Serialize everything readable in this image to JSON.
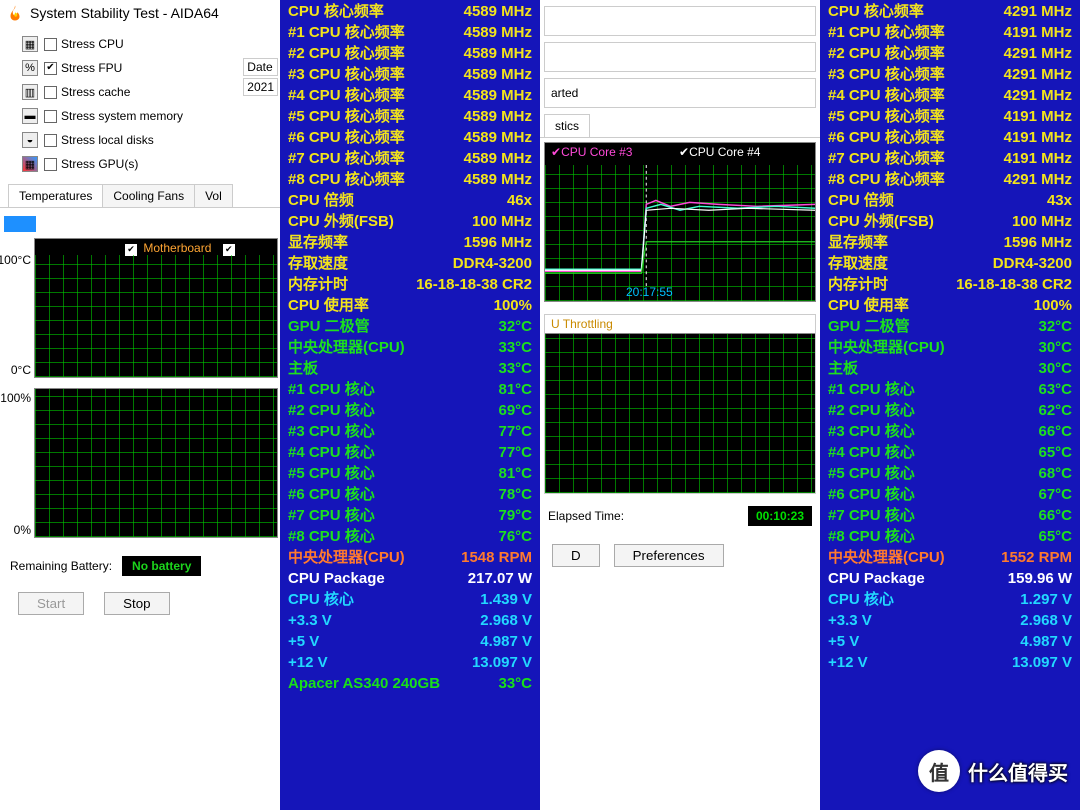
{
  "window": {
    "title": "System Stability Test - AIDA64"
  },
  "stress": {
    "cpu": {
      "label": "Stress CPU",
      "checked": false
    },
    "fpu": {
      "label": "Stress FPU",
      "checked": true
    },
    "cache": {
      "label": "Stress cache",
      "checked": false
    },
    "mem": {
      "label": "Stress system memory",
      "checked": false
    },
    "disks": {
      "label": "Stress local disks",
      "checked": false
    },
    "gpu": {
      "label": "Stress GPU(s)",
      "checked": false
    }
  },
  "date_label": "Date",
  "date_val": "2021",
  "tabs": {
    "temp": "Temperatures",
    "fans": "Cooling Fans",
    "vol": "Vol"
  },
  "mid_tab": "stics",
  "motherboard_label": "Motherboard",
  "graph1": {
    "y_top": "100°C",
    "y_bot": "0°C"
  },
  "graph2": {
    "y_top": "100%",
    "y_bot": "0%"
  },
  "mid_started": "arted",
  "cores": {
    "c3": "CPU Core #3",
    "c4": "CPU Core #4"
  },
  "timestamp": "20:17:55",
  "throttling_label": "U Throttling",
  "remaining_label": "Remaining Battery:",
  "battery_val": "No battery",
  "buttons": {
    "start": "Start",
    "stop": "Stop",
    "d": "D",
    "pref": "Preferences"
  },
  "elapsed_label": "Elapsed Time:",
  "elapsed_val": "00:10:23",
  "chart_data": {
    "type": "line",
    "title": "Core temperature vs time",
    "series": [
      {
        "name": "CPU Core #3",
        "color": "#ff4ad9"
      },
      {
        "name": "CPU Core #4",
        "color": "#ffffff"
      }
    ],
    "note": "Load begins near timestamp 20:17:55; temps rise from ~32°C idle to ~78°C plateau"
  },
  "stats1": [
    {
      "l": "CPU 核心频率",
      "v": "4589 MHz",
      "cl": "yellow"
    },
    {
      "l": "#1 CPU 核心频率",
      "v": "4589 MHz",
      "cl": "yellow"
    },
    {
      "l": "#2 CPU 核心频率",
      "v": "4589 MHz",
      "cl": "yellow"
    },
    {
      "l": "#3 CPU 核心频率",
      "v": "4589 MHz",
      "cl": "yellow"
    },
    {
      "l": "#4 CPU 核心频率",
      "v": "4589 MHz",
      "cl": "yellow"
    },
    {
      "l": "#5 CPU 核心频率",
      "v": "4589 MHz",
      "cl": "yellow"
    },
    {
      "l": "#6 CPU 核心频率",
      "v": "4589 MHz",
      "cl": "yellow"
    },
    {
      "l": "#7 CPU 核心频率",
      "v": "4589 MHz",
      "cl": "yellow"
    },
    {
      "l": "#8 CPU 核心频率",
      "v": "4589 MHz",
      "cl": "yellow"
    },
    {
      "l": "CPU 倍频",
      "v": "46x",
      "cl": "yellow"
    },
    {
      "l": "CPU 外频(FSB)",
      "v": "100 MHz",
      "cl": "yellow"
    },
    {
      "l": "显存频率",
      "v": "1596 MHz",
      "cl": "yellow"
    },
    {
      "l": "存取速度",
      "v": "DDR4-3200",
      "cl": "yellow"
    },
    {
      "l": "内存计时",
      "v": "16-18-18-38 CR2",
      "cl": "yellow"
    },
    {
      "l": "CPU 使用率",
      "v": "100%",
      "cl": "yellow"
    },
    {
      "l": "GPU 二极管",
      "v": "32°C",
      "cl": "green"
    },
    {
      "l": "中央处理器(CPU)",
      "v": "33°C",
      "cl": "green"
    },
    {
      "l": "主板",
      "v": "33°C",
      "cl": "green"
    },
    {
      "l": "#1 CPU 核心",
      "v": "81°C",
      "cl": "green"
    },
    {
      "l": "#2 CPU 核心",
      "v": "69°C",
      "cl": "green"
    },
    {
      "l": "#3 CPU 核心",
      "v": "77°C",
      "cl": "green"
    },
    {
      "l": "#4 CPU 核心",
      "v": "77°C",
      "cl": "green"
    },
    {
      "l": "#5 CPU 核心",
      "v": "81°C",
      "cl": "green"
    },
    {
      "l": "#6 CPU 核心",
      "v": "78°C",
      "cl": "green"
    },
    {
      "l": "#7 CPU 核心",
      "v": "79°C",
      "cl": "green"
    },
    {
      "l": "#8 CPU 核心",
      "v": "76°C",
      "cl": "green"
    },
    {
      "l": "中央处理器(CPU)",
      "v": "1548 RPM",
      "cl": "orange"
    },
    {
      "l": "CPU Package",
      "v": "217.07 W",
      "cl": "white"
    },
    {
      "l": "CPU 核心",
      "v": "1.439 V",
      "cl": "cyan"
    },
    {
      "l": "+3.3 V",
      "v": "2.968 V",
      "cl": "cyan"
    },
    {
      "l": "+5 V",
      "v": "4.987 V",
      "cl": "cyan"
    },
    {
      "l": "+12 V",
      "v": "13.097 V",
      "cl": "cyan"
    },
    {
      "l": "Apacer AS340 240GB",
      "v": "33°C",
      "cl": "apacer"
    }
  ],
  "stats2": [
    {
      "l": "CPU 核心频率",
      "v": "4291 MHz",
      "cl": "yellow"
    },
    {
      "l": "#1 CPU 核心频率",
      "v": "4191 MHz",
      "cl": "yellow"
    },
    {
      "l": "#2 CPU 核心频率",
      "v": "4291 MHz",
      "cl": "yellow"
    },
    {
      "l": "#3 CPU 核心频率",
      "v": "4291 MHz",
      "cl": "yellow"
    },
    {
      "l": "#4 CPU 核心频率",
      "v": "4291 MHz",
      "cl": "yellow"
    },
    {
      "l": "#5 CPU 核心频率",
      "v": "4191 MHz",
      "cl": "yellow"
    },
    {
      "l": "#6 CPU 核心频率",
      "v": "4191 MHz",
      "cl": "yellow"
    },
    {
      "l": "#7 CPU 核心频率",
      "v": "4191 MHz",
      "cl": "yellow"
    },
    {
      "l": "#8 CPU 核心频率",
      "v": "4291 MHz",
      "cl": "yellow"
    },
    {
      "l": "CPU 倍频",
      "v": "43x",
      "cl": "yellow"
    },
    {
      "l": "CPU 外频(FSB)",
      "v": "100 MHz",
      "cl": "yellow"
    },
    {
      "l": "显存频率",
      "v": "1596 MHz",
      "cl": "yellow"
    },
    {
      "l": "存取速度",
      "v": "DDR4-3200",
      "cl": "yellow"
    },
    {
      "l": "内存计时",
      "v": "16-18-18-38 CR2",
      "cl": "yellow"
    },
    {
      "l": "CPU 使用率",
      "v": "100%",
      "cl": "yellow"
    },
    {
      "l": "GPU 二极管",
      "v": "32°C",
      "cl": "green"
    },
    {
      "l": "中央处理器(CPU)",
      "v": "30°C",
      "cl": "green"
    },
    {
      "l": "主板",
      "v": "30°C",
      "cl": "green"
    },
    {
      "l": "#1 CPU 核心",
      "v": "63°C",
      "cl": "green"
    },
    {
      "l": "#2 CPU 核心",
      "v": "62°C",
      "cl": "green"
    },
    {
      "l": "#3 CPU 核心",
      "v": "66°C",
      "cl": "green"
    },
    {
      "l": "#4 CPU 核心",
      "v": "65°C",
      "cl": "green"
    },
    {
      "l": "#5 CPU 核心",
      "v": "68°C",
      "cl": "green"
    },
    {
      "l": "#6 CPU 核心",
      "v": "67°C",
      "cl": "green"
    },
    {
      "l": "#7 CPU 核心",
      "v": "66°C",
      "cl": "green"
    },
    {
      "l": "#8 CPU 核心",
      "v": "65°C",
      "cl": "green"
    },
    {
      "l": "中央处理器(CPU)",
      "v": "1552 RPM",
      "cl": "orange"
    },
    {
      "l": "CPU Package",
      "v": "159.96 W",
      "cl": "white"
    },
    {
      "l": "CPU 核心",
      "v": "1.297 V",
      "cl": "cyan"
    },
    {
      "l": "+3.3 V",
      "v": "2.968 V",
      "cl": "cyan"
    },
    {
      "l": "+5 V",
      "v": "4.987 V",
      "cl": "cyan"
    },
    {
      "l": "+12 V",
      "v": "13.097 V",
      "cl": "cyan"
    }
  ],
  "watermark": {
    "char": "值",
    "text": "什么值得买"
  }
}
